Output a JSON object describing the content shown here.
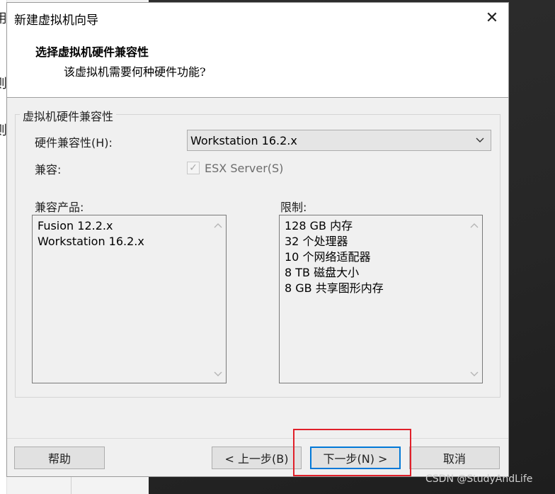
{
  "background": {
    "left_glyphs": [
      "用",
      "则",
      "则"
    ]
  },
  "dialog": {
    "title": "新建虚拟机向导",
    "close_glyph": "✕",
    "header_title": "选择虚拟机硬件兼容性",
    "header_subtitle": "该虚拟机需要何种硬件功能?"
  },
  "group": {
    "legend": "虚拟机硬件兼容性",
    "hw_label": "硬件兼容性(H):",
    "hw_selected": "Workstation 16.2.x",
    "compat_label": "兼容:",
    "esx_checked_glyph": "✓",
    "esx_label": "ESX Server(S)",
    "products_label": "兼容产品:",
    "products": [
      "Fusion 12.2.x",
      "Workstation 16.2.x"
    ],
    "limits_label": "限制:",
    "limits": [
      "128 GB 内存",
      "32 个处理器",
      "10 个网络适配器",
      "8 TB 磁盘大小",
      "8 GB 共享图形内存"
    ]
  },
  "buttons": {
    "help": "帮助",
    "back": "< 上一步(B)",
    "next": "下一步(N) >",
    "cancel": "取消"
  },
  "watermark": "CSDN @StudyAndLife",
  "colors": {
    "highlight": "#e0202a",
    "focus": "#0078d7"
  }
}
